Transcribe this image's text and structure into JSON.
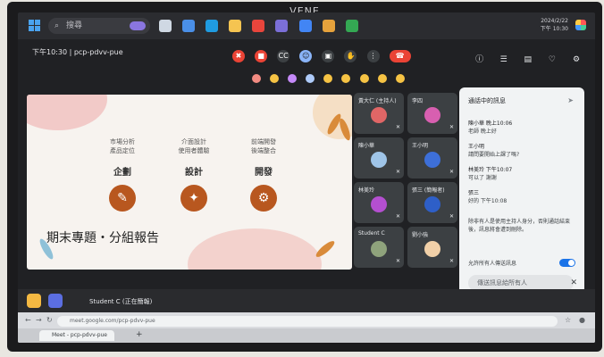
{
  "monitor_brand": "VENE",
  "taskbar": {
    "search_placeholder": "搜尋",
    "clock_time": "下午 10:30",
    "clock_date": "2024/2/22"
  },
  "meet": {
    "time_code": "下午10:30 | pcp-pdvv-pue",
    "chat_panel": {
      "header": "通話中的訊息",
      "messages": [
        {
          "who": "陳小華 晚上10:06",
          "text": "老師 晚上好"
        },
        {
          "who": "王小明",
          "text": "請問要開始上課了嗎?"
        },
        {
          "who": "林美玲 下午10:07",
          "text": "可以了 謝謝"
        },
        {
          "who": "張三",
          "text": "好的 下午10:08"
        }
      ],
      "notice": "除非有人是使用主持人身分，否則通話結束後，訊息將會遭到刪除。",
      "toggle_label": "允許所有人傳送訊息",
      "input_placeholder": "傳送訊息給所有人"
    },
    "participants": [
      {
        "name": "黃大仁 (主持人)"
      },
      {
        "name": "李四"
      },
      {
        "name": "陳小華"
      },
      {
        "name": "王小明"
      },
      {
        "name": "林美玲"
      },
      {
        "name": "張三 (簡報者)"
      },
      {
        "name": "Student C"
      },
      {
        "name": "劉小強"
      }
    ],
    "presenter_label": "Student C (正在簡報)"
  },
  "slide": {
    "title": "期末專題・分組報告",
    "columns": [
      {
        "heading": "企劃",
        "bullets": [
          "市場分析",
          "產品定位"
        ]
      },
      {
        "heading": "設計",
        "bullets": [
          "介面設計",
          "使用者體驗"
        ]
      },
      {
        "heading": "開發",
        "bullets": [
          "前端開發",
          "後端整合"
        ]
      }
    ]
  },
  "browser": {
    "url": "meet.google.com/pcp-pdvv-pue",
    "tab_title": "Meet - pcp-pdvv-pue"
  }
}
